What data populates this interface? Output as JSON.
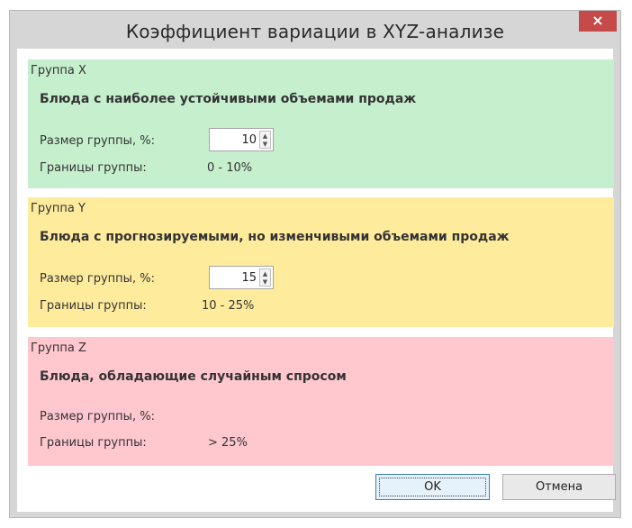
{
  "window": {
    "title": "Коэффициент вариации в XYZ-анализе",
    "close_label": "×"
  },
  "groups": [
    {
      "name": "Группа X",
      "description": "Блюда с наиболее устойчивыми объемами продаж",
      "size_label": "Размер группы, %:",
      "size_value": "10",
      "bounds_label": "Границы группы:",
      "bounds_value": "0 - 10%",
      "color": "#c6efce"
    },
    {
      "name": "Группа Y",
      "description": "Блюда с прогнозируемыми, но изменчивыми объемами продаж",
      "size_label": "Размер группы, %:",
      "size_value": "15",
      "bounds_label": "Границы группы:",
      "bounds_value": "10 - 25%",
      "color": "#ffeb9c"
    },
    {
      "name": "Группа Z",
      "description": "Блюда, обладающие случайным спросом",
      "size_label": "Размер группы, %:",
      "bounds_label": "Границы группы:",
      "bounds_value": "> 25%",
      "color": "#ffc7ce"
    }
  ],
  "buttons": {
    "ok": "OK",
    "cancel": "Отмена"
  }
}
